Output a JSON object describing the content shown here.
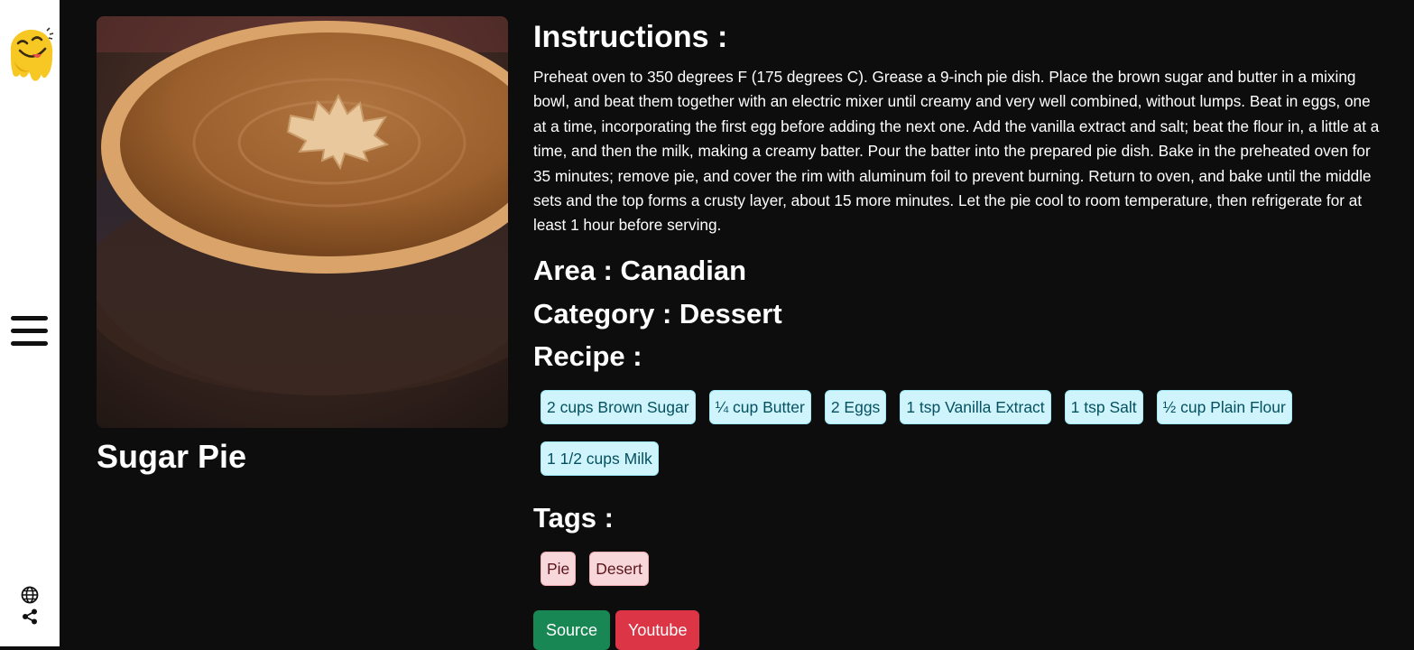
{
  "sidebar": {
    "logo": "smiley-logo-icon",
    "menu": "hamburger-menu-icon",
    "language": "globe-icon",
    "share": "share-icon"
  },
  "meal": {
    "name": "Sugar Pie",
    "image": "sugar-pie-photo"
  },
  "instructions": {
    "heading": "Instructions :",
    "text": "Preheat oven to 350 degrees F (175 degrees C). Grease a 9-inch pie dish. Place the brown sugar and butter in a mixing bowl, and beat them together with an electric mixer until creamy and very well combined, without lumps. Beat in eggs, one at a time, incorporating the first egg before adding the next one. Add the vanilla extract and salt; beat the flour in, a little at a time, and then the milk, making a creamy batter. Pour the batter into the prepared pie dish. Bake in the preheated oven for 35 minutes; remove pie, and cover the rim with aluminum foil to prevent burning. Return to oven, and bake until the middle sets and the top forms a crusty layer, about 15 more minutes. Let the pie cool to room temperature, then refrigerate for at least 1 hour before serving."
  },
  "area": "Area : Canadian",
  "category": "Category : Dessert",
  "recipe": {
    "heading": "Recipe :",
    "ingredients": [
      "2 cups Brown Sugar",
      "¼ cup Butter",
      "2 Eggs",
      "1 tsp Vanilla Extract",
      "1 tsp Salt",
      "½ cup Plain Flour",
      "1 1/2 cups Milk"
    ]
  },
  "tags": {
    "heading": "Tags :",
    "items": [
      "Pie",
      "Desert"
    ]
  },
  "buttons": {
    "source": "Source",
    "youtube": "Youtube"
  },
  "colors": {
    "background": "#0d0d0d",
    "ingredient_badge": "#cff4fc",
    "tag_badge": "#f8d7da",
    "source_button": "#198754",
    "youtube_button": "#dc3545"
  }
}
